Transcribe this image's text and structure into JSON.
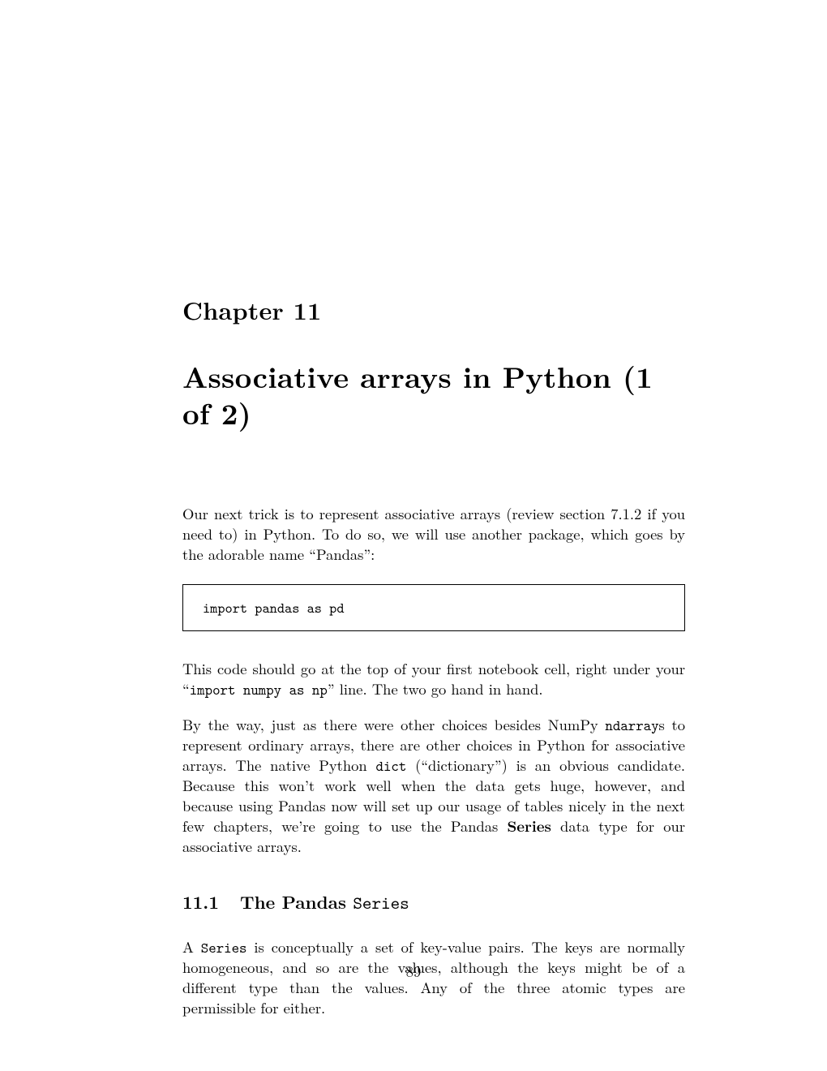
{
  "chapter": {
    "label": "Chapter 11",
    "title": "Associative arrays in Python (1 of 2)"
  },
  "para1": {
    "t1": "Our next trick is to represent associative arrays (review section 7.1.2 if you need to) in Python. To do so, we will use another package, which goes by the adorable name “Pandas”:"
  },
  "code": {
    "line1": "import pandas as pd"
  },
  "para2": {
    "t1": "This code should go at the top of your first notebook cell, right under your “",
    "c1": "import numpy as np",
    "t2": "” line. The two go hand in hand."
  },
  "para3": {
    "t1": "By the way, just as there were other choices besides NumPy ",
    "c1": "ndarray",
    "t2": "s to represent ordinary arrays, there are other choices in Python for associative arrays. The native Python ",
    "c2": "dict",
    "t3": " (“dictionary”) is an obvious candidate. Because this won’t work well when the data gets huge, however, and because using Pandas now will set up our usage of tables nicely in the next few chapters, we’re going to use the Pandas ",
    "b1": "Series",
    "t4": " data type for our associative arrays."
  },
  "section": {
    "num": "11.1",
    "t1": "The Pandas ",
    "c1": "Series"
  },
  "para4": {
    "t1": "A ",
    "c1": "Series",
    "t2": " is conceptually a set of key-value pairs. The keys are normally homogeneous, and so are the values, although the keys might be of a different type than the values. Any of the three atomic types are permissible for either."
  },
  "pageNumber": "89"
}
